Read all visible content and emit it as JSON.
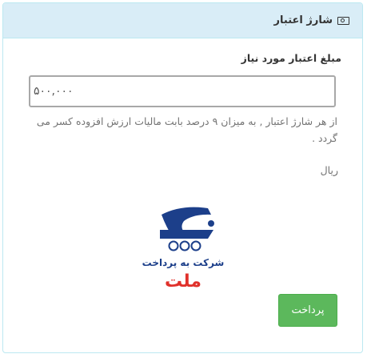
{
  "header": {
    "title": "شارژ اعتبار",
    "icon": "money-icon"
  },
  "form": {
    "amount_label": "مبلغ اعتبار مورد نیاز",
    "amount_value": "۵۰۰,۰۰۰",
    "help_text": "از هر شارژ اعتبار , به میزان ۹ درصد بابت مالیات ارزش افزوده کسر می گردد .",
    "currency": "ریال"
  },
  "logo": {
    "company_text": "شرکت به پرداخت",
    "brand_text": "ملت",
    "colors": {
      "navy": "#1c3f8a",
      "red": "#e0312b"
    }
  },
  "actions": {
    "pay_label": "پرداخت",
    "pay_color": "#5cb85c"
  }
}
